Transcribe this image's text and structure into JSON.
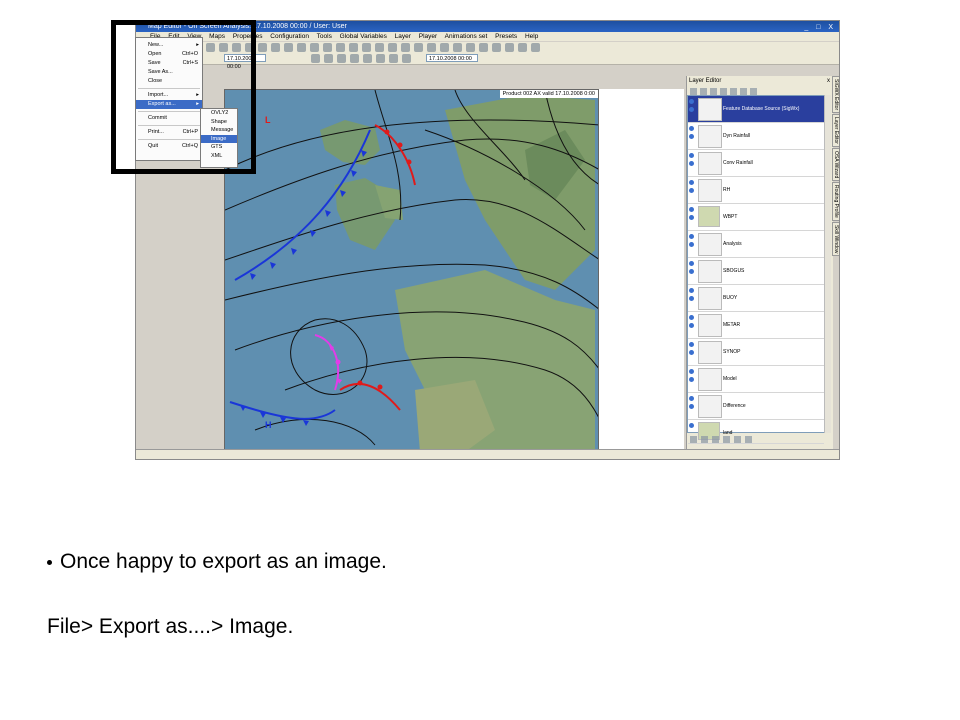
{
  "window": {
    "title": "Map Editor - On Screen Analysis: 17.10.2008 00:00 / User: User",
    "controls": "_ □ X"
  },
  "menubar": [
    "File",
    "Edit",
    "View",
    "Maps",
    "Properties",
    "Configuration",
    "Tools",
    "Global Variables",
    "Layer",
    "Player",
    "Animations set",
    "Presets",
    "Help"
  ],
  "toolbar": {
    "date_field_1": "17.10.2008 00:00",
    "date_field_2": "17.10.2008 00:00"
  },
  "map": {
    "header": "Product 002 AX valid 17.10.2008 0:00",
    "labels": {
      "low_letter": "L",
      "high_letter": "H"
    }
  },
  "file_menu": {
    "items": [
      {
        "label": "New...",
        "shortcut": "",
        "arrow": "▸"
      },
      {
        "label": "Open",
        "shortcut": "Ctrl+O",
        "arrow": ""
      },
      {
        "label": "Save",
        "shortcut": "Ctrl+S",
        "arrow": ""
      },
      {
        "label": "Save As...",
        "shortcut": "",
        "arrow": ""
      },
      {
        "label": "Close",
        "shortcut": "",
        "arrow": ""
      },
      {
        "label": "Import...",
        "shortcut": "",
        "arrow": "▸"
      },
      {
        "label": "Export as...",
        "shortcut": "",
        "arrow": "▸"
      },
      {
        "label": "Commit",
        "shortcut": "",
        "arrow": ""
      },
      {
        "label": "Print...",
        "shortcut": "Ctrl+P",
        "arrow": "▸"
      },
      {
        "label": "Quit",
        "shortcut": "Ctrl+Q",
        "arrow": ""
      }
    ]
  },
  "export_submenu": [
    "OVLY2",
    "Shape",
    "Message",
    "Image",
    "GTS",
    "XML"
  ],
  "layer_editor": {
    "title": "Layer Editor",
    "close": "x",
    "layers": [
      "Feature Database Source (SigWx)",
      "Dyn Rainfall",
      "Conv Rainfall",
      "RH",
      "WBPT",
      "Analysis",
      "SBOGUS",
      "BUOY",
      "METAR",
      "SYNOP",
      "Model",
      "Difference",
      "land"
    ]
  },
  "side_tabs": [
    "SIGWX Editor",
    "Layer Editor",
    "OSA Wizard",
    "Routing Profile",
    "Skill Window"
  ],
  "slide": {
    "bullet": "Once happy to export as an image.",
    "path": "File> Export as....> Image."
  }
}
